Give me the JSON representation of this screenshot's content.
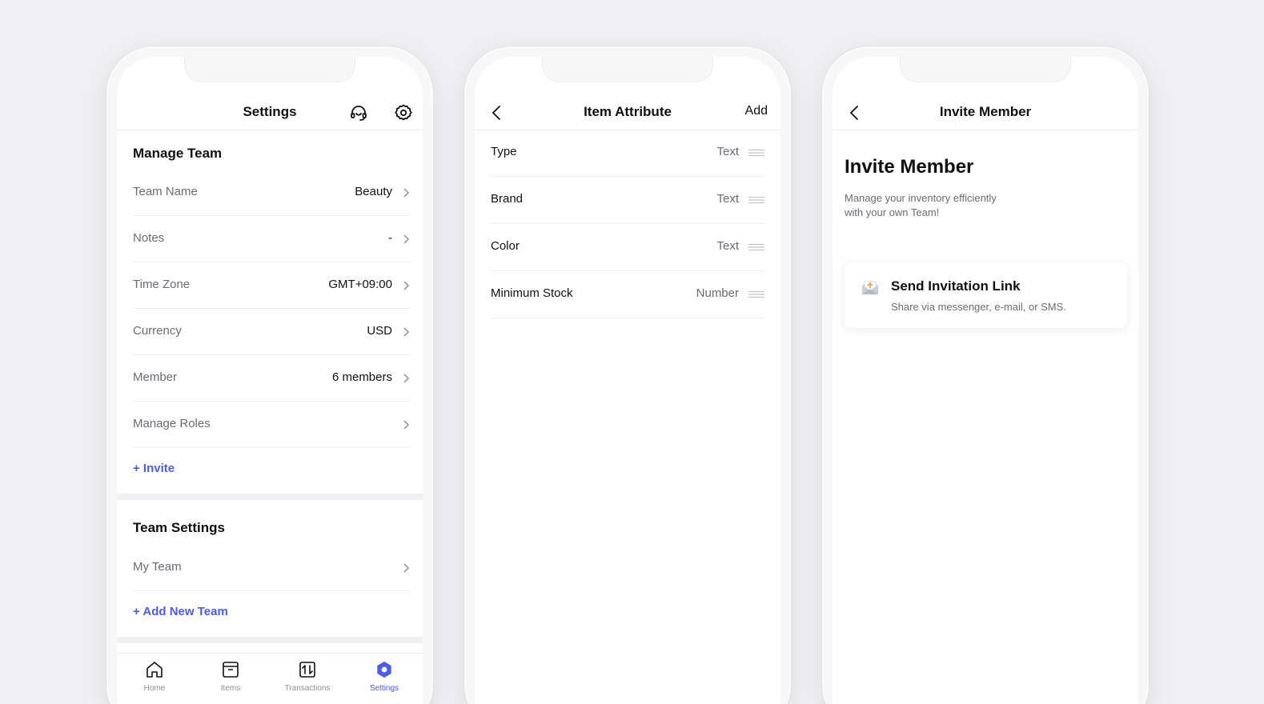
{
  "settings_screen": {
    "title": "Settings",
    "manage_team": {
      "heading": "Manage Team",
      "rows": [
        {
          "label": "Team Name",
          "value": "Beauty"
        },
        {
          "label": "Notes",
          "value": "-"
        },
        {
          "label": "Time Zone",
          "value": "GMT+09:00"
        },
        {
          "label": "Currency",
          "value": "USD"
        },
        {
          "label": "Member",
          "value": "6 members"
        },
        {
          "label": "Manage Roles",
          "value": ""
        }
      ],
      "invite_link": "+ Invite"
    },
    "team_settings": {
      "heading": "Team Settings",
      "rows": [
        {
          "label": "My Team"
        }
      ],
      "add_link": "+ Add New Team"
    },
    "tabbar": [
      {
        "label": "Home",
        "icon": "home-icon"
      },
      {
        "label": "Items",
        "icon": "box-icon"
      },
      {
        "label": "Transactions",
        "icon": "transactions-icon"
      },
      {
        "label": "Settings",
        "icon": "settings-gear-icon",
        "active": true
      }
    ],
    "accent_color": "#4a5bf0"
  },
  "attribute_screen": {
    "title": "Item Attribute",
    "action": "Add",
    "rows": [
      {
        "label": "Type",
        "value": "Text"
      },
      {
        "label": "Brand",
        "value": "Text"
      },
      {
        "label": "Color",
        "value": "Text"
      },
      {
        "label": "Minimum Stock",
        "value": "Number"
      }
    ]
  },
  "invite_screen": {
    "title": "Invite Member",
    "heading": "Invite Member",
    "subtitle_line1": "Manage your inventory efficiently",
    "subtitle_line2": "with your own Team!",
    "card": {
      "title": "Send Invitation Link",
      "subtitle": "Share via messenger, e-mail, or SMS.",
      "icon": "envelope-icon"
    }
  }
}
